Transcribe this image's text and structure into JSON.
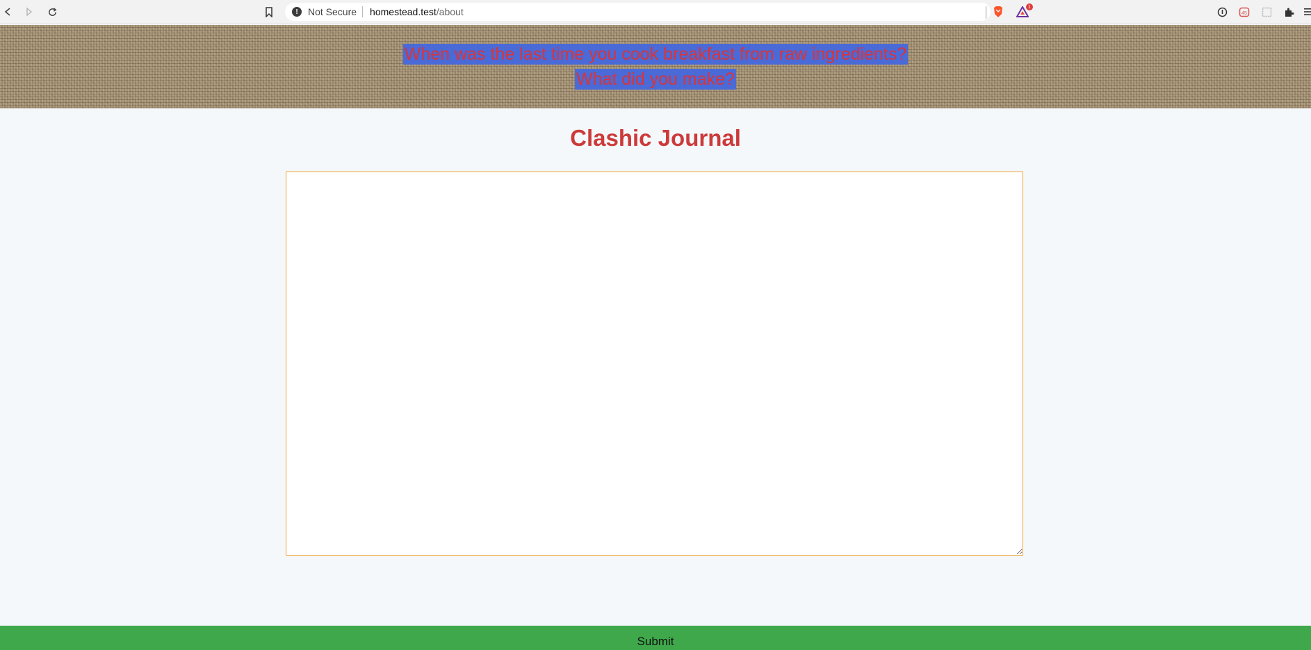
{
  "browser": {
    "security_label": "Not Secure",
    "url_host": "homestead.test",
    "url_path": "/about",
    "badge_count": "1",
    "icons": [
      "back-icon",
      "forward-icon",
      "reload-icon",
      "bookmark-icon",
      "warning-icon",
      "brave-shield-icon",
      "bat-rewards-icon",
      "info-icon",
      "extension-icon",
      "puzzle-icon",
      "menu-icon"
    ]
  },
  "header": {
    "prompt_line_1": "When was the last time you cook breakfast from raw ingredients?",
    "prompt_line_2": "What did you make?"
  },
  "main": {
    "title": "Clashic Journal",
    "journal_value": "",
    "submit_label": "Submit"
  },
  "colors": {
    "title": "#cc3a3a",
    "prompt_text": "#d8343a",
    "prompt_highlight": "#4a6ad8",
    "textarea_border": "#f0a030",
    "submit_bg": "#3ea84a",
    "page_bg": "#f5f8fa"
  }
}
